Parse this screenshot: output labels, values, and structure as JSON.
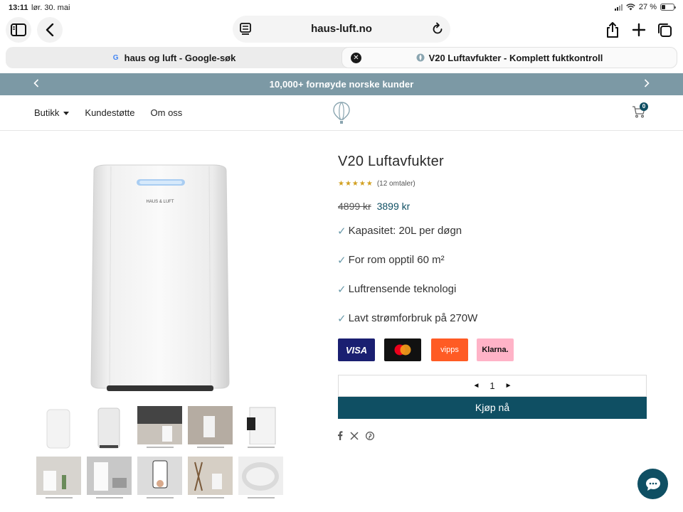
{
  "status_bar": {
    "time": "13:11",
    "date": "lør. 30. mai",
    "battery": "27 %"
  },
  "browser": {
    "url": "haus-luft.no",
    "tabs": [
      {
        "title": "haus og luft - Google-søk",
        "favicon": "G"
      },
      {
        "title": "V20 Luftavfukter - Komplett fuktkontroll",
        "favicon": "balloon-icon"
      }
    ]
  },
  "announcement": {
    "message": "10,000+ fornøyde norske kunder"
  },
  "header": {
    "nav": [
      {
        "label": "Butikk"
      },
      {
        "label": "Kundestøtte"
      },
      {
        "label": "Om oss"
      }
    ],
    "cart_count": "0"
  },
  "main_image": {
    "brand_label": "HAUS & LUFT"
  },
  "product": {
    "title": "V20 Luftavfukter",
    "stars": "★★★★★",
    "reviews": "(12 omtaler)",
    "price_old": "4899 kr",
    "price_new": "3899 kr",
    "features": [
      "Kapasitet: 20L per døgn",
      "For rom opptil 60 m²",
      "Luftrensende teknologi",
      "Lavt strømforbruk på 270W"
    ],
    "check_mark": "✓",
    "payments": {
      "visa": "VISA",
      "vipps": "vipps",
      "klarna": "Klarna."
    },
    "quantity": "1",
    "buy_label": "Kjøp nå"
  },
  "colors": {
    "accent": "#0f4f63",
    "announcement_bg": "#7c99a5",
    "stars": "#d2a021"
  }
}
